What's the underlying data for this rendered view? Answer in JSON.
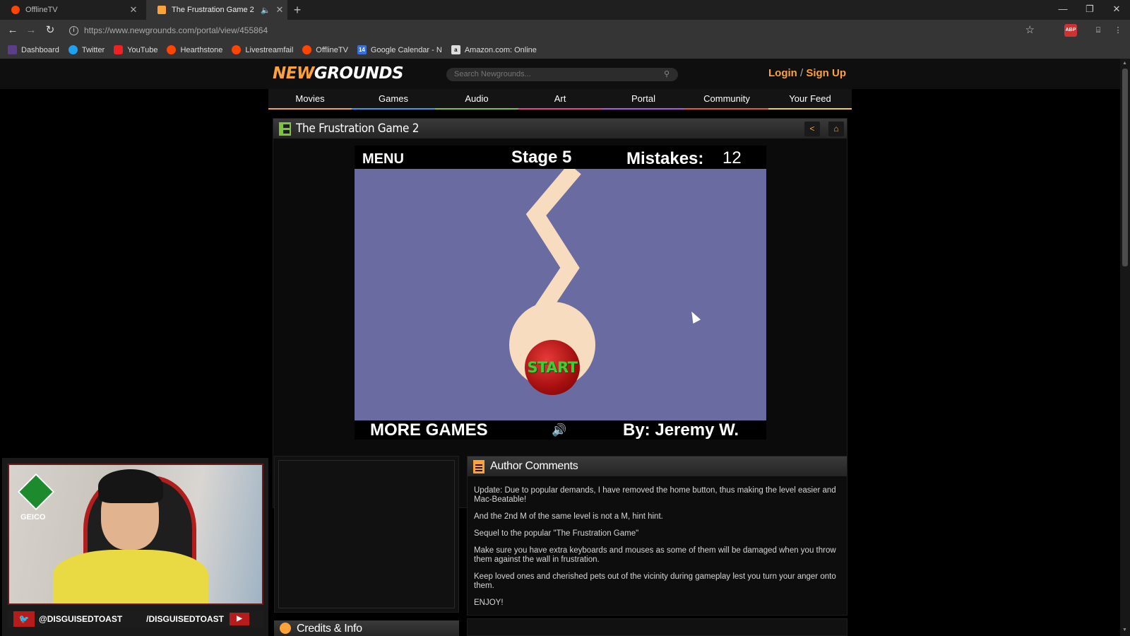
{
  "browser": {
    "tabs": [
      {
        "title": "OfflineTV",
        "active": false
      },
      {
        "title": "The Frustration Game 2",
        "active": true
      }
    ],
    "url": "https://www.newgrounds.com/portal/view/455864",
    "ext_abp": "ABP",
    "bookmarks": [
      {
        "label": "Dashboard",
        "icon": "tumblr-icon",
        "color": "#5a3e8a"
      },
      {
        "label": "Twitter",
        "icon": "twitter-icon",
        "color": "#1da1f2"
      },
      {
        "label": "YouTube",
        "icon": "youtube-icon",
        "color": "#e22"
      },
      {
        "label": "Hearthstone",
        "icon": "reddit-icon",
        "color": "#ff4500"
      },
      {
        "label": "Livestreamfail",
        "icon": "reddit-icon",
        "color": "#ff4500"
      },
      {
        "label": "OfflineTV",
        "icon": "reddit-icon",
        "color": "#ff4500"
      },
      {
        "label": "Google Calendar - N",
        "icon": "calendar-icon",
        "color": "#3b6fd8",
        "badge": "14"
      },
      {
        "label": "Amazon.com: Online",
        "icon": "amazon-icon",
        "color": "#ddd",
        "badge": "a"
      }
    ]
  },
  "site": {
    "logo_part1": "NEW",
    "logo_part2": "GROUNDS",
    "search_placeholder": "Search Newgrounds...",
    "login": "Login",
    "login_sep": "/",
    "signup": "Sign Up",
    "nav": [
      {
        "label": "Movies",
        "color": "#f2a93b"
      },
      {
        "label": "Games",
        "color": "#3a9ee8"
      },
      {
        "label": "Audio",
        "color": "#7fc33a"
      },
      {
        "label": "Art",
        "color": "#e8418f"
      },
      {
        "label": "Portal",
        "color": "#b357e0"
      },
      {
        "label": "Community",
        "color": "#e85b2e"
      },
      {
        "label": "Your Feed",
        "color": "#f2d03b"
      }
    ]
  },
  "game_panel": {
    "title": "The Frustration Game 2",
    "share_icon": "share-icon",
    "favorite_icon": "favorite-icon"
  },
  "game": {
    "menu": "MENU",
    "stage": "Stage 5",
    "mistakes_label": "Mistakes:",
    "mistakes": "12",
    "start": "START",
    "more_games": "MORE GAMES",
    "by": "By: Jeremy W.",
    "field_color": "#6a6ba0",
    "path_color": "#f8dcc0"
  },
  "stream": {
    "sponsor": "GEICO",
    "twitter_handle": "@DISGUISEDTOAST",
    "youtube_handle": "/DISGUISEDTOAST"
  },
  "author_comments": {
    "title": "Author Comments",
    "paragraphs": [
      "Update: Due to popular demands, I have removed the home button, thus making the level easier and Mac-Beatable!",
      "And the 2nd M of the same level is not a M, hint hint.",
      "Sequel to the popular \"The Frustration Game\"",
      "Make sure you have extra keyboards and mouses as some of them will be damaged when you throw them against the wall in frustration.",
      "Keep loved ones and cherished pets out of the vicinity during gameplay lest you turn your anger onto them.",
      "ENJOY!"
    ]
  },
  "credits": {
    "title": "Credits & Info"
  }
}
